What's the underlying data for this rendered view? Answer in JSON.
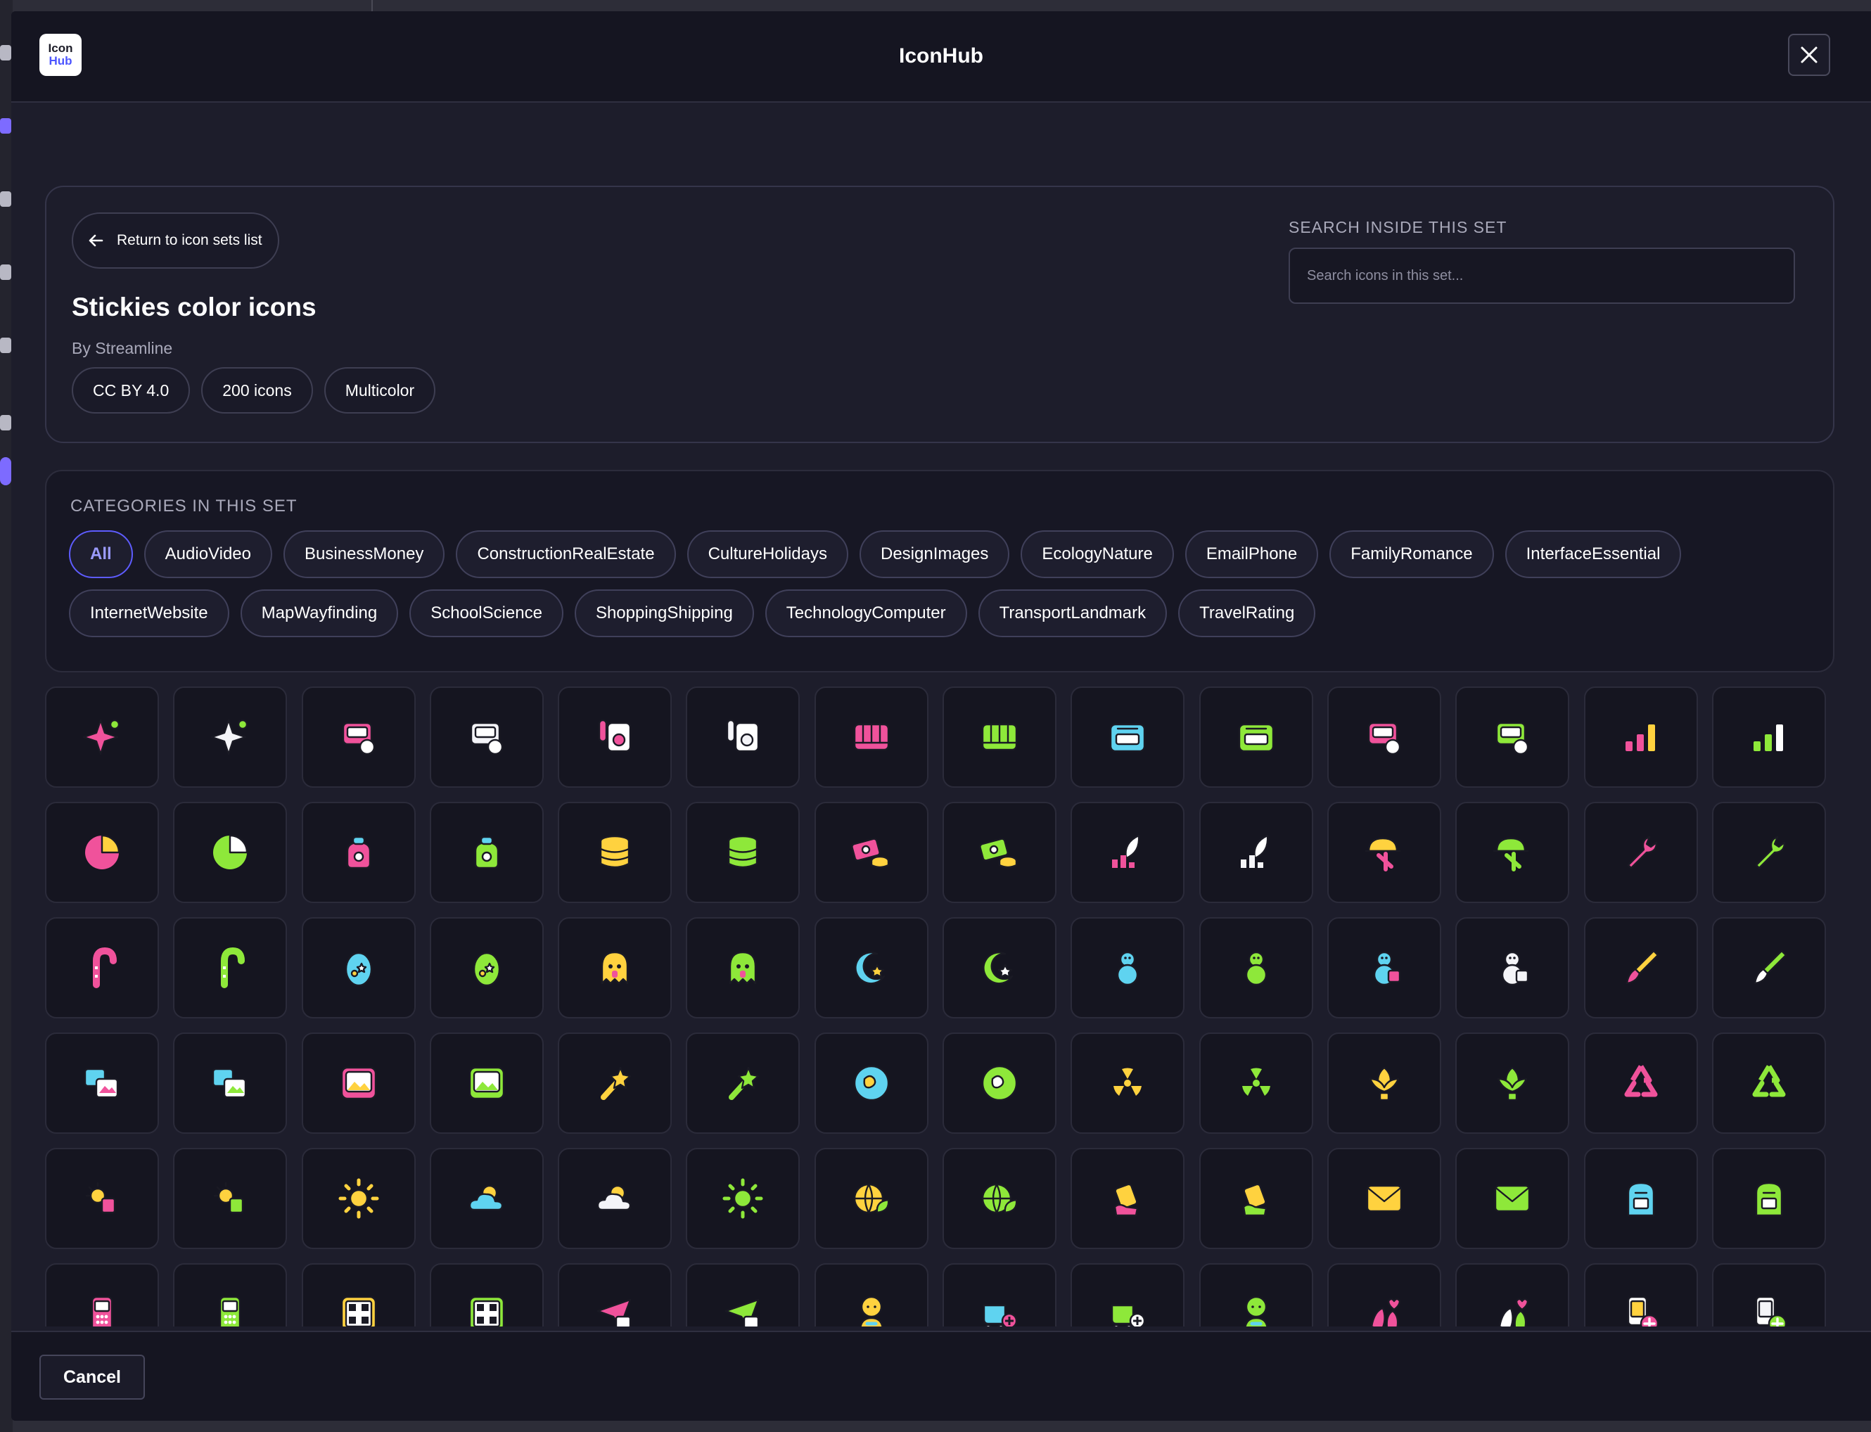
{
  "app": {
    "title": "IconHub",
    "logo_line1": "Icon",
    "logo_line2": "Hub"
  },
  "set_header": {
    "return_label": "Return to icon sets list",
    "title": "Stickies color icons",
    "author": "By Streamline",
    "badges": [
      "CC BY 4.0",
      "200 icons",
      "Multicolor"
    ],
    "search_label": "SEARCH INSIDE THIS SET",
    "search_placeholder": "Search icons in this set...",
    "search_value": ""
  },
  "categories": {
    "label": "CATEGORIES IN THIS SET",
    "selected": "All",
    "items": [
      "All",
      "AudioVideo",
      "BusinessMoney",
      "ConstructionRealEstate",
      "CultureHolidays",
      "DesignImages",
      "EcologyNature",
      "EmailPhone",
      "FamilyRomance",
      "InterfaceEssential",
      "InternetWebsite",
      "MapWayfinding",
      "SchoolScience",
      "ShoppingShipping",
      "TechnologyComputer",
      "TransportLandmark",
      "TravelRating"
    ]
  },
  "colors": {
    "pink": "#f0529b",
    "white": "#f4f4f8",
    "lime": "#8ee83a",
    "cyan": "#5fd3f0",
    "yellow": "#ffd23f",
    "accent": "#5e5cff"
  },
  "icons": [
    {
      "name": "bluetooth-note-icon",
      "shape": "sparkle",
      "color": "pink"
    },
    {
      "name": "bluetooth-note-icon",
      "shape": "sparkle",
      "color": "white"
    },
    {
      "name": "camera-film-icon",
      "shape": "screen",
      "color": "pink"
    },
    {
      "name": "camera-film-icon",
      "shape": "screen",
      "color": "white"
    },
    {
      "name": "speaker-guitar-icon",
      "shape": "speaker",
      "color": "pink"
    },
    {
      "name": "speaker-guitar-icon",
      "shape": "speaker",
      "color": "white"
    },
    {
      "name": "piano-keys-icon",
      "shape": "piano",
      "color": "pink"
    },
    {
      "name": "piano-keys-icon",
      "shape": "piano",
      "color": "lime"
    },
    {
      "name": "radio-player-icon",
      "shape": "radio",
      "color": "cyan"
    },
    {
      "name": "radio-player-icon",
      "shape": "radio",
      "color": "lime"
    },
    {
      "name": "tv-remote-icon",
      "shape": "screen",
      "color": "pink"
    },
    {
      "name": "tv-remote-icon",
      "shape": "screen",
      "color": "lime"
    },
    {
      "name": "signal-bars-icon",
      "shape": "bars",
      "color": "pink"
    },
    {
      "name": "signal-bars-icon",
      "shape": "bars",
      "color": "lime"
    },
    {
      "name": "pie-chart-icon",
      "shape": "pie",
      "color": "pink"
    },
    {
      "name": "pie-chart-icon",
      "shape": "pie",
      "color": "lime"
    },
    {
      "name": "money-bag-icon",
      "shape": "bag",
      "color": "pink"
    },
    {
      "name": "money-bag-icon",
      "shape": "bag",
      "color": "lime"
    },
    {
      "name": "coin-stack-icon",
      "shape": "coins",
      "color": "yellow"
    },
    {
      "name": "coin-stack-icon",
      "shape": "coins",
      "color": "lime"
    },
    {
      "name": "cash-coins-icon",
      "shape": "cash",
      "color": "pink"
    },
    {
      "name": "cash-coins-icon",
      "shape": "cash",
      "color": "lime"
    },
    {
      "name": "rocket-growth-icon",
      "shape": "rocket",
      "color": "pink"
    },
    {
      "name": "rocket-growth-icon",
      "shape": "rocket",
      "color": "white"
    },
    {
      "name": "helmet-barrier-icon",
      "shape": "helmet",
      "color": "yellow"
    },
    {
      "name": "helmet-barrier-icon",
      "shape": "helmet",
      "color": "lime"
    },
    {
      "name": "wrench-icon",
      "shape": "wrench",
      "color": "pink"
    },
    {
      "name": "wrench-icon",
      "shape": "wrench",
      "color": "lime"
    },
    {
      "name": "candy-cane-icon",
      "shape": "cane",
      "color": "pink"
    },
    {
      "name": "candy-cane-icon",
      "shape": "cane",
      "color": "lime"
    },
    {
      "name": "easter-egg-icon",
      "shape": "egg",
      "color": "cyan"
    },
    {
      "name": "easter-egg-icon",
      "shape": "egg",
      "color": "lime"
    },
    {
      "name": "ghost-monster-icon",
      "shape": "ghost",
      "color": "yellow"
    },
    {
      "name": "ghost-monster-icon",
      "shape": "ghost",
      "color": "lime"
    },
    {
      "name": "moon-star-icon",
      "shape": "moon",
      "color": "cyan"
    },
    {
      "name": "moon-star-icon",
      "shape": "moon",
      "color": "lime"
    },
    {
      "name": "snowman-icon",
      "shape": "snowman",
      "color": "cyan"
    },
    {
      "name": "snowman-icon",
      "shape": "snowman",
      "color": "lime"
    },
    {
      "name": "snowman-gift-icon",
      "shape": "snowman",
      "color": "pink"
    },
    {
      "name": "snowman-gift-icon",
      "shape": "snowman",
      "color": "white"
    },
    {
      "name": "paint-brush-icon",
      "shape": "brush",
      "color": "yellow"
    },
    {
      "name": "paint-brush-icon",
      "shape": "brush",
      "color": "lime"
    },
    {
      "name": "photo-gallery-icon",
      "shape": "photos",
      "color": "pink"
    },
    {
      "name": "photo-gallery-icon",
      "shape": "photos",
      "color": "lime"
    },
    {
      "name": "image-frame-icon",
      "shape": "frame",
      "color": "pink"
    },
    {
      "name": "image-frame-icon",
      "shape": "frame",
      "color": "lime"
    },
    {
      "name": "magic-wand-icon",
      "shape": "wand",
      "color": "yellow"
    },
    {
      "name": "magic-wand-icon",
      "shape": "wand",
      "color": "lime"
    },
    {
      "name": "earth-globe-icon",
      "shape": "globe",
      "color": "cyan"
    },
    {
      "name": "earth-globe-icon",
      "shape": "globe",
      "color": "lime"
    },
    {
      "name": "radioactive-icon",
      "shape": "nuclear",
      "color": "yellow"
    },
    {
      "name": "radioactive-icon",
      "shape": "nuclear",
      "color": "lime"
    },
    {
      "name": "plant-sprout-icon",
      "shape": "leaf",
      "color": "yellow"
    },
    {
      "name": "plant-sprout-icon",
      "shape": "leaf",
      "color": "lime"
    },
    {
      "name": "recycle-icon",
      "shape": "recycle",
      "color": "pink"
    },
    {
      "name": "recycle-icon",
      "shape": "recycle",
      "color": "lime"
    },
    {
      "name": "sun-battery-icon",
      "shape": "sunbat",
      "color": "pink"
    },
    {
      "name": "sun-battery-icon",
      "shape": "sunbat",
      "color": "lime"
    },
    {
      "name": "sun-icon",
      "shape": "sun",
      "color": "yellow"
    },
    {
      "name": "sun-cloud-icon",
      "shape": "suncloud",
      "color": "cyan"
    },
    {
      "name": "sun-cloud-icon",
      "shape": "suncloud",
      "color": "white"
    },
    {
      "name": "sun-icon",
      "shape": "sun",
      "color": "lime"
    },
    {
      "name": "globe-leaf-icon",
      "shape": "globeleaf",
      "color": "yellow"
    },
    {
      "name": "globe-leaf-icon",
      "shape": "globeleaf",
      "color": "lime"
    },
    {
      "name": "phone-hand-icon",
      "shape": "phone",
      "color": "pink"
    },
    {
      "name": "phone-hand-icon",
      "shape": "phone",
      "color": "lime"
    },
    {
      "name": "envelope-icon",
      "shape": "envelope",
      "color": "yellow"
    },
    {
      "name": "envelope-icon",
      "shape": "envelope",
      "color": "lime"
    },
    {
      "name": "mailbox-icon",
      "shape": "mailbox",
      "color": "cyan"
    },
    {
      "name": "mailbox-icon",
      "shape": "mailbox",
      "color": "lime"
    },
    {
      "name": "mobile-phone-icon",
      "shape": "mobile",
      "color": "pink"
    },
    {
      "name": "mobile-phone-icon",
      "shape": "mobile",
      "color": "lime"
    },
    {
      "name": "qr-code-icon",
      "shape": "qr",
      "color": "yellow"
    },
    {
      "name": "qr-code-icon",
      "shape": "qr",
      "color": "lime"
    },
    {
      "name": "paper-plane-icon",
      "shape": "plane",
      "color": "pink"
    },
    {
      "name": "paper-plane-icon",
      "shape": "plane",
      "color": "lime"
    },
    {
      "name": "baby-icon",
      "shape": "baby",
      "color": "yellow"
    },
    {
      "name": "baby-stroller-icon",
      "shape": "stroller",
      "color": "cyan"
    },
    {
      "name": "baby-stroller-icon",
      "shape": "stroller",
      "color": "lime"
    },
    {
      "name": "baby-icon",
      "shape": "baby",
      "color": "lime"
    },
    {
      "name": "couple-heart-icon",
      "shape": "couple",
      "color": "pink"
    },
    {
      "name": "couple-heart-icon",
      "shape": "couple",
      "color": "white"
    },
    {
      "name": "phone-add-icon",
      "shape": "phoneadd",
      "color": "yellow"
    },
    {
      "name": "phone-add-icon",
      "shape": "phoneadd",
      "color": "white"
    }
  ],
  "footer": {
    "cancel_label": "Cancel"
  }
}
